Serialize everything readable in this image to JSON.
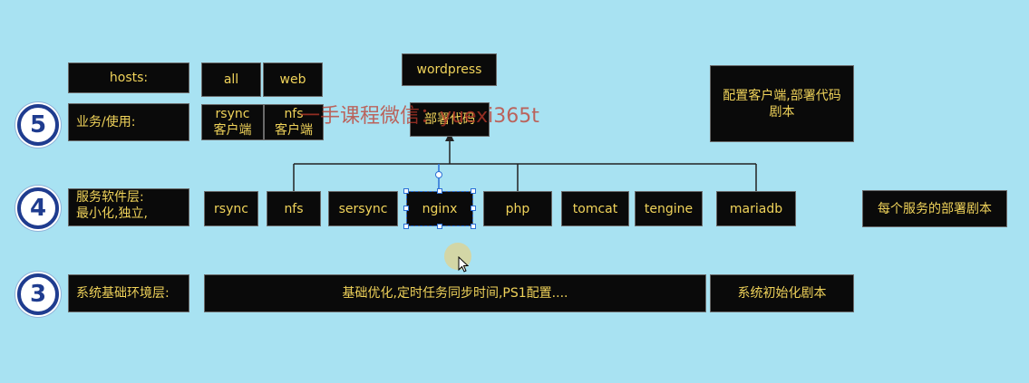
{
  "level_badges": {
    "l5": "5",
    "l4": "4",
    "l3": "3"
  },
  "layer_labels": {
    "hosts": "hosts:",
    "business": "业务/使用:",
    "service_line1": "服务软件层:",
    "service_line2": "最小化,独立,",
    "system": "系统基础环境层:"
  },
  "hosts": {
    "all": "all",
    "web": "web"
  },
  "clients": {
    "rsync_l1": "rsync",
    "rsync_l2": "客户端",
    "nfs_l1": "nfs",
    "nfs_l2": "客户端"
  },
  "top": {
    "wordpress": "wordpress",
    "deploy_code": "部署代码"
  },
  "services": {
    "rsync": "rsync",
    "nfs": "nfs",
    "sersync": "sersync",
    "nginx": "nginx",
    "php": "php",
    "tomcat": "tomcat",
    "tengine": "tengine",
    "mariadb": "mariadb"
  },
  "scripts": {
    "client_deploy_l1": "配置客户端,部署代码",
    "client_deploy_l2": "剧本",
    "per_service": "每个服务的部署剧本",
    "system_init": "系统初始化剧本"
  },
  "base_env": "基础优化,定时任务同步时间,PS1配置....",
  "watermark": "一手课程微信：yuexi365t",
  "colors": {
    "background": "#a8e2f2",
    "box": "#0a0a0a",
    "text": "#f0d35a",
    "badge": "#1f3c8f"
  }
}
